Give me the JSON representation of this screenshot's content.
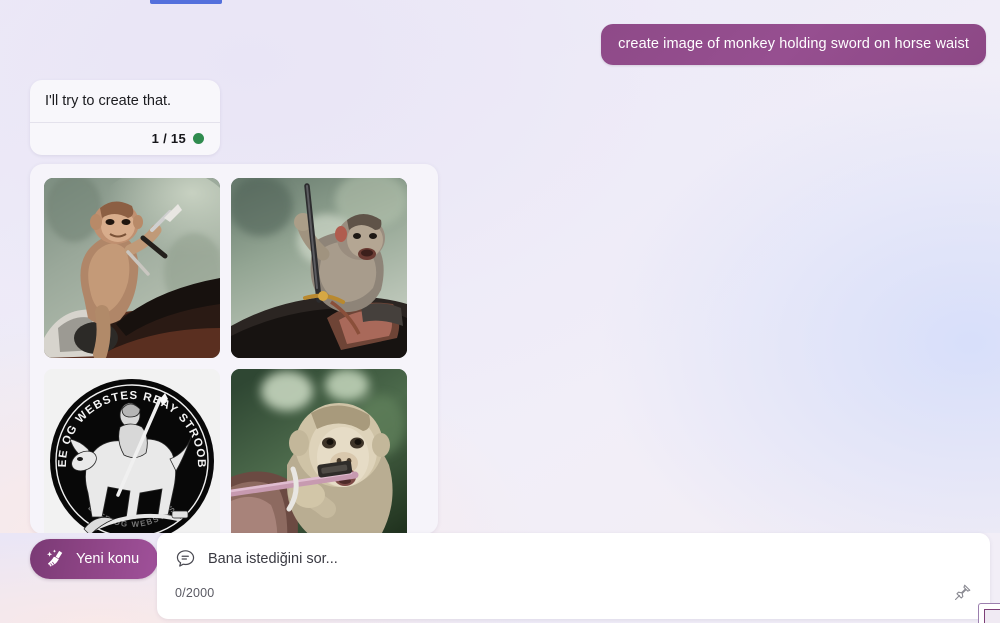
{
  "browser": {
    "active_tab_indicator_color": "#5470dc"
  },
  "conversation": {
    "user_message": {
      "text": "create image of monkey holding sword on horse waist",
      "bubble_color": "#8e4a88"
    },
    "assistant_message": {
      "text": "I'll try to create that.",
      "counter": "1 / 15",
      "status_dot_color": "#2f8b4e"
    },
    "results": [
      {
        "name": "monkey-with-sword-on-brown-horse",
        "description": "Macaque monkey raising a sword while seated on a brown horse with saddle, blurred green forest background"
      },
      {
        "name": "monkey-holding-upright-sword-on-horse",
        "description": "Monkey gripping a long upright sword blade astride a dark horse with leather saddle, blurred green background"
      },
      {
        "name": "black-circular-knight-emblem",
        "description": "Black circular coin emblem depicting an armoured knight with lance on a rearing horse",
        "emblem_top_text": "OEE OG WEBSTES REAY STROOBE",
        "emblem_bottom_text": "LEEE OG WEBSTES"
      },
      {
        "name": "monkey-closeup-gripping-sword",
        "description": "Close-up of a pale macaque monkey with open mouth gripping a sword hilt over a horse's mane"
      }
    ]
  },
  "composer": {
    "new_topic_label": "Yeni konu",
    "new_topic_icon": "broom-sparkle-icon",
    "input_placeholder": "Bana istediğini sor...",
    "input_value": "",
    "char_count": "0/2000",
    "chat_icon": "speech-bubble-icon",
    "pin_icon": "pushpin-icon"
  }
}
